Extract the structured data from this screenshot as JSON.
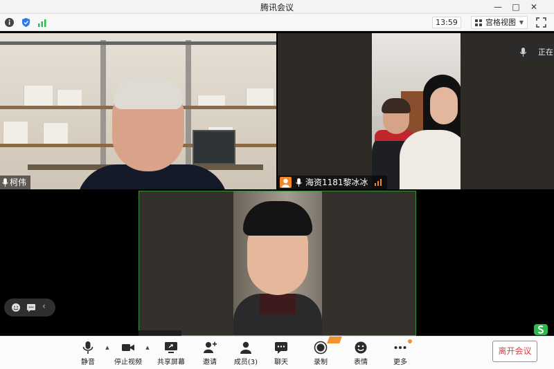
{
  "window": {
    "title": "腾讯会议"
  },
  "topbar": {
    "time": "13:59",
    "view_label": "宫格视图",
    "status_colors": {
      "info": "#3b3b3b",
      "shield": "#2e7be5",
      "signal": "#2fb84f"
    }
  },
  "tiles": [
    {
      "name": "柯伟",
      "mic": "mic-icon"
    },
    {
      "name": "海资1181黎冰冰",
      "mic": "mic-icon"
    },
    {
      "name": "",
      "mic": ""
    }
  ],
  "speaking_label": "正在讠",
  "toolbar": {
    "mute": "静音",
    "stop_video": "停止视频",
    "share_screen": "共享屏幕",
    "invite": "邀请",
    "members": "成员(3)",
    "chat": "聊天",
    "record": "录制",
    "reactions": "表情",
    "more": "更多",
    "leave": "离开会议"
  },
  "colors": {
    "accent_orange": "#f0922e",
    "leave_red": "#e03c3f",
    "active_border": "#3a8f3e"
  }
}
